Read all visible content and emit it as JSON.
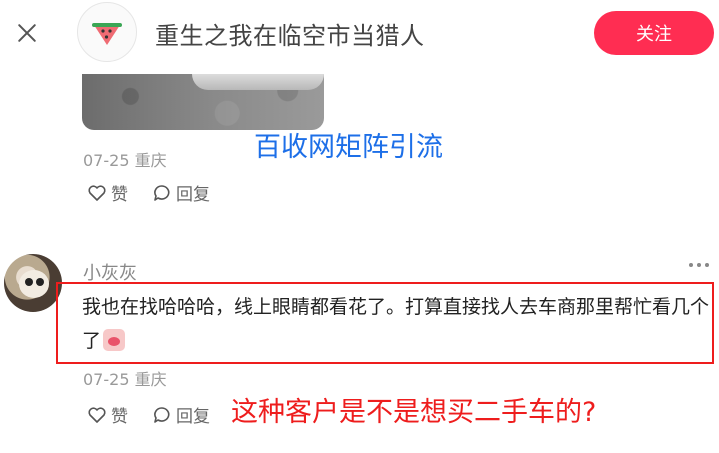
{
  "header": {
    "avatar_emoji": "🍉",
    "nickname": "重生之我在临空市当猎人",
    "follow_label": "关注"
  },
  "watermark": "百收网矩阵引流",
  "comments": [
    {
      "date": "07-25",
      "location": "重庆",
      "like_label": "赞",
      "reply_label": "回复"
    },
    {
      "username": "小灰灰",
      "text": "我也在找哈哈哈，线上眼睛都看花了。打算直接找人去车商那里帮忙看几个了",
      "date": "07-25",
      "location": "重庆",
      "like_label": "赞",
      "reply_label": "回复"
    }
  ],
  "annotation": "这种客户是不是想买二手车的?",
  "colors": {
    "accent": "#ff2d52",
    "watermark": "#1d6fe8",
    "highlight": "#ee1d1d"
  }
}
